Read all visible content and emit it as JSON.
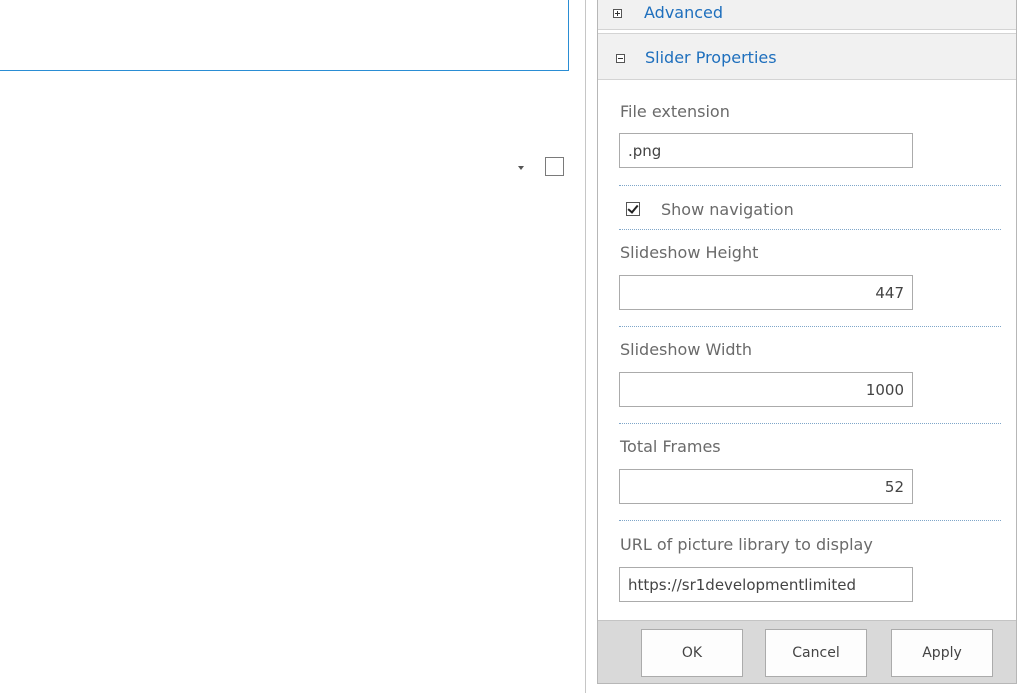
{
  "toolpane": {
    "advanced": {
      "toggle": "expand",
      "title": "Advanced"
    },
    "slider": {
      "toggle": "collapse",
      "title": "Slider Properties",
      "file_extension": {
        "label": "File extension",
        "value": ".png"
      },
      "show_navigation": {
        "label": "Show navigation",
        "checked": true
      },
      "slideshow_height": {
        "label": "Slideshow Height",
        "value": "447"
      },
      "slideshow_width": {
        "label": "Slideshow Width",
        "value": "1000"
      },
      "total_frames": {
        "label": "Total Frames",
        "value": "52"
      },
      "picture_library_url": {
        "label": "URL of picture library to display",
        "value": "https://sr1developmentlimited"
      }
    },
    "buttons": {
      "ok": "OK",
      "cancel": "Cancel",
      "apply": "Apply"
    }
  },
  "icons": {
    "expand": "plus-box-icon",
    "collapse": "minus-box-icon",
    "menu": "dropdown-arrow-icon",
    "select": "empty-checkbox-icon"
  },
  "colors": {
    "accent": "#1e6fbd",
    "webpart_border": "#2a8dd4",
    "header_bg": "#f1f1f1",
    "footer_bg": "#d9d9d9"
  }
}
